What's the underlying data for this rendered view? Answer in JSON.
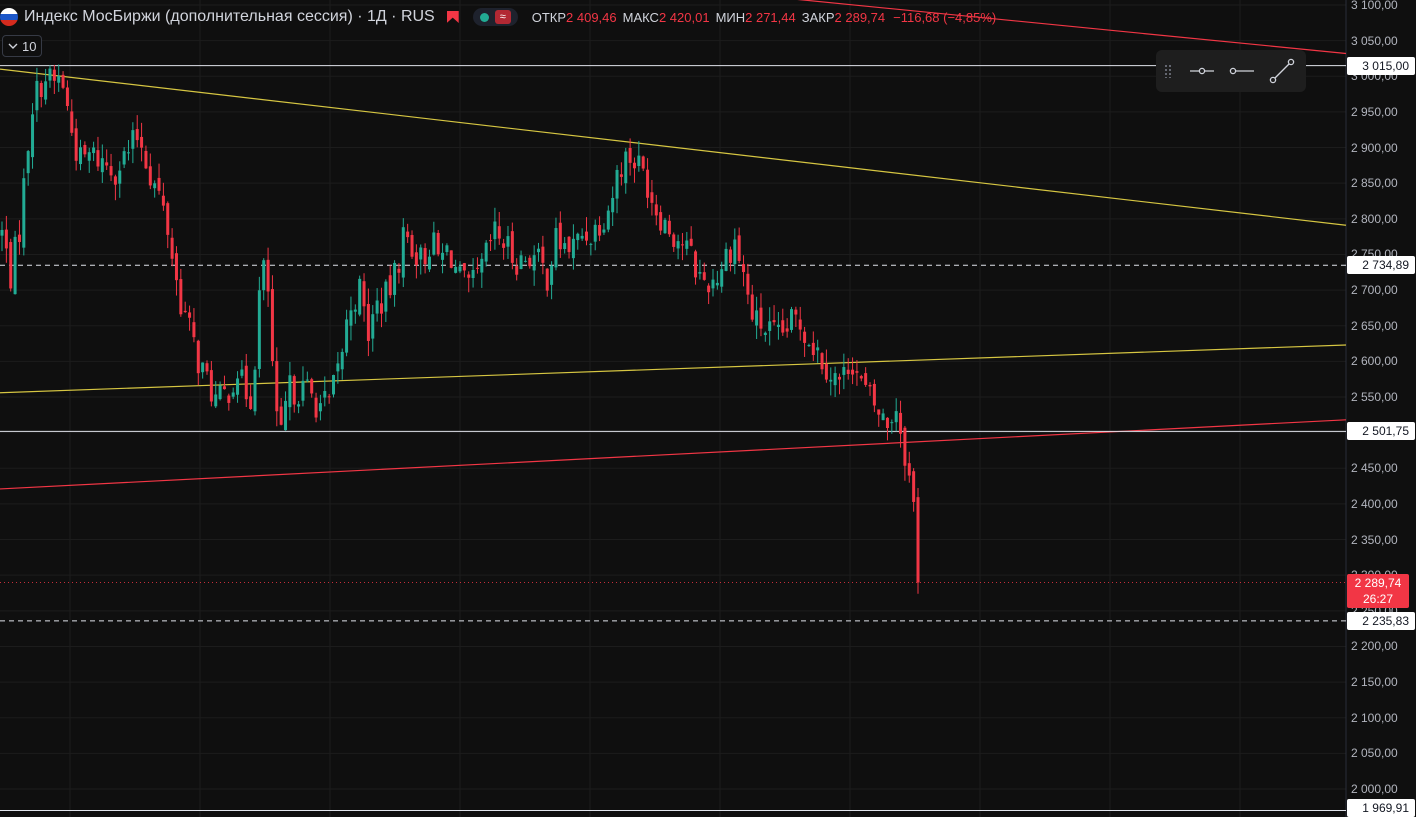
{
  "header": {
    "title": "Индекс МосБиржи (дополнительная сессия) · 1Д · RUS",
    "open_label": "ОТКР",
    "open_value": "2 409,46",
    "high_label": "МАКС",
    "high_value": "2 420,01",
    "low_label": "МИН",
    "low_value": "2 271,44",
    "close_label": "ЗАКР",
    "close_value": "2 289,74",
    "change": "−116,68 (−4,85%)"
  },
  "interval_button": {
    "label": "10"
  },
  "colors": {
    "background": "#0f0f0f",
    "up": "#22ab94",
    "down": "#f23645",
    "yellow_trend": "#d6c642",
    "red_trend": "#f23645",
    "grid": "#1c1c1c"
  },
  "axis": {
    "tick_labels": [
      "3 100,00",
      "3 050,00",
      "3 000,00",
      "2 950,00",
      "2 900,00",
      "2 850,00",
      "2 800,00",
      "2 750,00",
      "2 700,00",
      "2 650,00",
      "2 600,00",
      "2 550,00",
      "2 500,00",
      "2 450,00",
      "2 400,00",
      "2 350,00",
      "2 300,00",
      "2 250,00",
      "2 200,00",
      "2 150,00",
      "2 100,00",
      "2 050,00",
      "2 000,00"
    ]
  },
  "price_tags": [
    {
      "label": "3 015,00",
      "value": 3015.0,
      "style": "solid"
    },
    {
      "label": "2 734,89",
      "value": 2734.89,
      "style": "dashed"
    },
    {
      "label": "2 501,75",
      "value": 2501.75,
      "style": "solid"
    },
    {
      "label": "2 235,83",
      "value": 2235.83,
      "style": "dashed"
    },
    {
      "label": "1 969,91",
      "value": 1969.91,
      "style": "solid"
    }
  ],
  "last_price": {
    "label": "2 289,74",
    "countdown": "26:27",
    "value": 2289.74
  },
  "chart_data": {
    "type": "candlestick",
    "title": "Индекс МосБиржи (дополнительная сессия) · 1Д · RUS",
    "y_range": [
      1960,
      3110
    ],
    "grid": true,
    "n_bars": 211,
    "close_path": [
      [
        0,
        2780
      ],
      [
        6,
        2720
      ],
      [
        12,
        2790
      ],
      [
        20,
        2960
      ],
      [
        28,
        3000
      ],
      [
        35,
        2990
      ],
      [
        40,
        3000
      ],
      [
        46,
        2930
      ],
      [
        52,
        2880
      ],
      [
        60,
        2890
      ],
      [
        68,
        2880
      ],
      [
        76,
        2870
      ],
      [
        84,
        2890
      ],
      [
        92,
        2920
      ],
      [
        100,
        2860
      ],
      [
        106,
        2830
      ],
      [
        112,
        2780
      ],
      [
        118,
        2700
      ],
      [
        125,
        2650
      ],
      [
        132,
        2600
      ],
      [
        138,
        2570
      ],
      [
        145,
        2540
      ],
      [
        152,
        2560
      ],
      [
        158,
        2590
      ],
      [
        162,
        2560
      ],
      [
        168,
        2550
      ],
      [
        174,
        2730
      ],
      [
        178,
        2720
      ],
      [
        182,
        2580
      ],
      [
        186,
        2470
      ],
      [
        192,
        2560
      ],
      [
        198,
        2560
      ],
      [
        205,
        2560
      ],
      [
        212,
        2540
      ],
      [
        220,
        2540
      ],
      [
        226,
        2590
      ],
      [
        234,
        2680
      ],
      [
        240,
        2700
      ],
      [
        246,
        2640
      ],
      [
        252,
        2680
      ],
      [
        258,
        2690
      ],
      [
        264,
        2720
      ],
      [
        270,
        2780
      ],
      [
        276,
        2760
      ],
      [
        282,
        2740
      ],
      [
        288,
        2770
      ],
      [
        294,
        2740
      ],
      [
        300,
        2760
      ],
      [
        306,
        2720
      ],
      [
        312,
        2700
      ],
      [
        318,
        2710
      ],
      [
        324,
        2740
      ],
      [
        330,
        2780
      ],
      [
        336,
        2770
      ],
      [
        342,
        2750
      ],
      [
        348,
        2740
      ],
      [
        354,
        2750
      ],
      [
        360,
        2740
      ],
      [
        366,
        2720
      ],
      [
        372,
        2770
      ],
      [
        378,
        2760
      ],
      [
        384,
        2760
      ],
      [
        390,
        2780
      ],
      [
        396,
        2780
      ],
      [
        402,
        2800
      ],
      [
        408,
        2820
      ],
      [
        414,
        2870
      ],
      [
        420,
        2890
      ],
      [
        426,
        2880
      ],
      [
        432,
        2860
      ],
      [
        438,
        2820
      ],
      [
        444,
        2800
      ],
      [
        450,
        2780
      ],
      [
        456,
        2770
      ],
      [
        462,
        2750
      ],
      [
        468,
        2720
      ],
      [
        474,
        2710
      ],
      [
        480,
        2720
      ],
      [
        486,
        2750
      ],
      [
        492,
        2770
      ],
      [
        498,
        2720
      ],
      [
        504,
        2660
      ],
      [
        510,
        2650
      ],
      [
        516,
        2640
      ],
      [
        522,
        2630
      ],
      [
        528,
        2650
      ],
      [
        534,
        2660
      ],
      [
        540,
        2640
      ],
      [
        546,
        2620
      ],
      [
        552,
        2600
      ],
      [
        558,
        2580
      ],
      [
        564,
        2570
      ],
      [
        570,
        2610
      ],
      [
        576,
        2570
      ],
      [
        582,
        2550
      ],
      [
        588,
        2530
      ],
      [
        594,
        2510
      ],
      [
        600,
        2540
      ],
      [
        604,
        2500
      ],
      [
        608,
        2450
      ],
      [
        612,
        2400
      ],
      [
        615,
        2285
      ]
    ],
    "close_path_x_units": "bar_index",
    "trend_lines": [
      {
        "color": "yellow",
        "from": [
          0,
          3010
        ],
        "to": [
          1346,
          2791
        ]
      },
      {
        "color": "yellow",
        "from": [
          0,
          2556
        ],
        "to": [
          1346,
          2623
        ]
      },
      {
        "color": "red",
        "from": [
          0,
          2421
        ],
        "to": [
          1346,
          2518
        ]
      },
      {
        "color": "red",
        "from": [
          760,
          3113
        ],
        "to": [
          1346,
          3032
        ]
      }
    ]
  }
}
